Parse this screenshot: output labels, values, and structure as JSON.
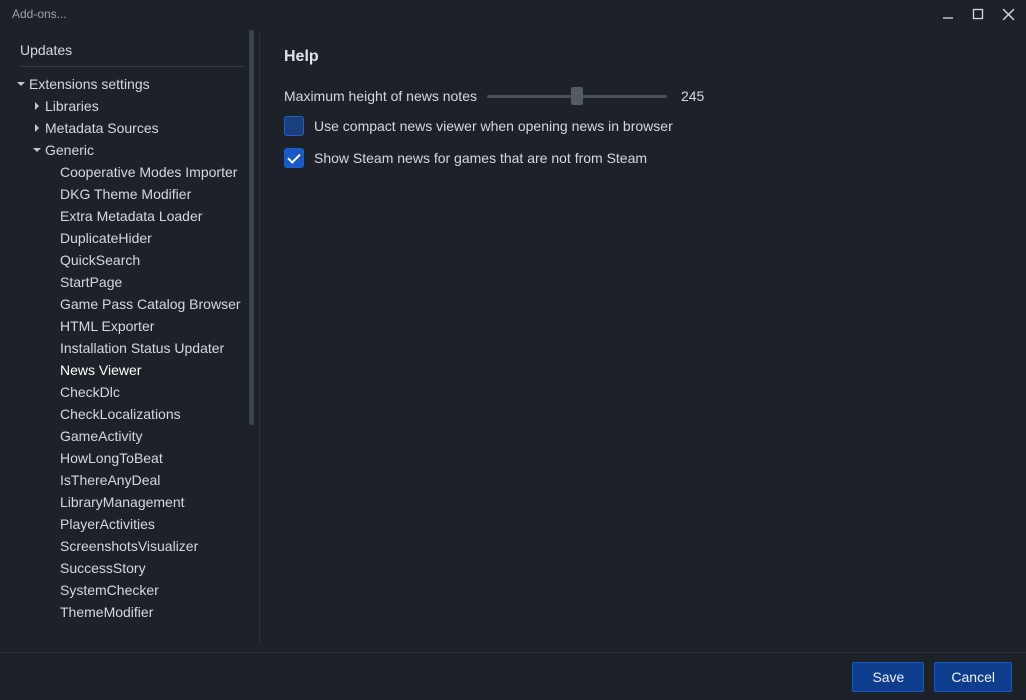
{
  "window": {
    "title": "Add-ons..."
  },
  "sidebar": {
    "updates_label": "Updates",
    "root": {
      "label": "Extensions settings",
      "children": [
        {
          "label": "Libraries",
          "expanded": false
        },
        {
          "label": "Metadata Sources",
          "expanded": false
        },
        {
          "label": "Generic",
          "expanded": true,
          "items": [
            "Cooperative Modes Importer",
            "DKG Theme Modifier",
            "Extra Metadata Loader",
            "DuplicateHider",
            "QuickSearch",
            "StartPage",
            "Game Pass Catalog Browser",
            "HTML Exporter",
            "Installation Status Updater",
            "News Viewer",
            "CheckDlc",
            "CheckLocalizations",
            "GameActivity",
            "HowLongToBeat",
            "IsThereAnyDeal",
            "LibraryManagement",
            "PlayerActivities",
            "ScreenshotsVisualizer",
            "SuccessStory",
            "SystemChecker",
            "ThemeModifier"
          ],
          "selected": "News Viewer"
        }
      ]
    }
  },
  "panel": {
    "title": "Help",
    "slider": {
      "label": "Maximum height of news notes",
      "value": "245"
    },
    "checks": [
      {
        "label": "Use compact news viewer when opening news in browser",
        "checked": false
      },
      {
        "label": "Show Steam news for games that are not from Steam",
        "checked": true
      }
    ]
  },
  "footer": {
    "save": "Save",
    "cancel": "Cancel"
  }
}
